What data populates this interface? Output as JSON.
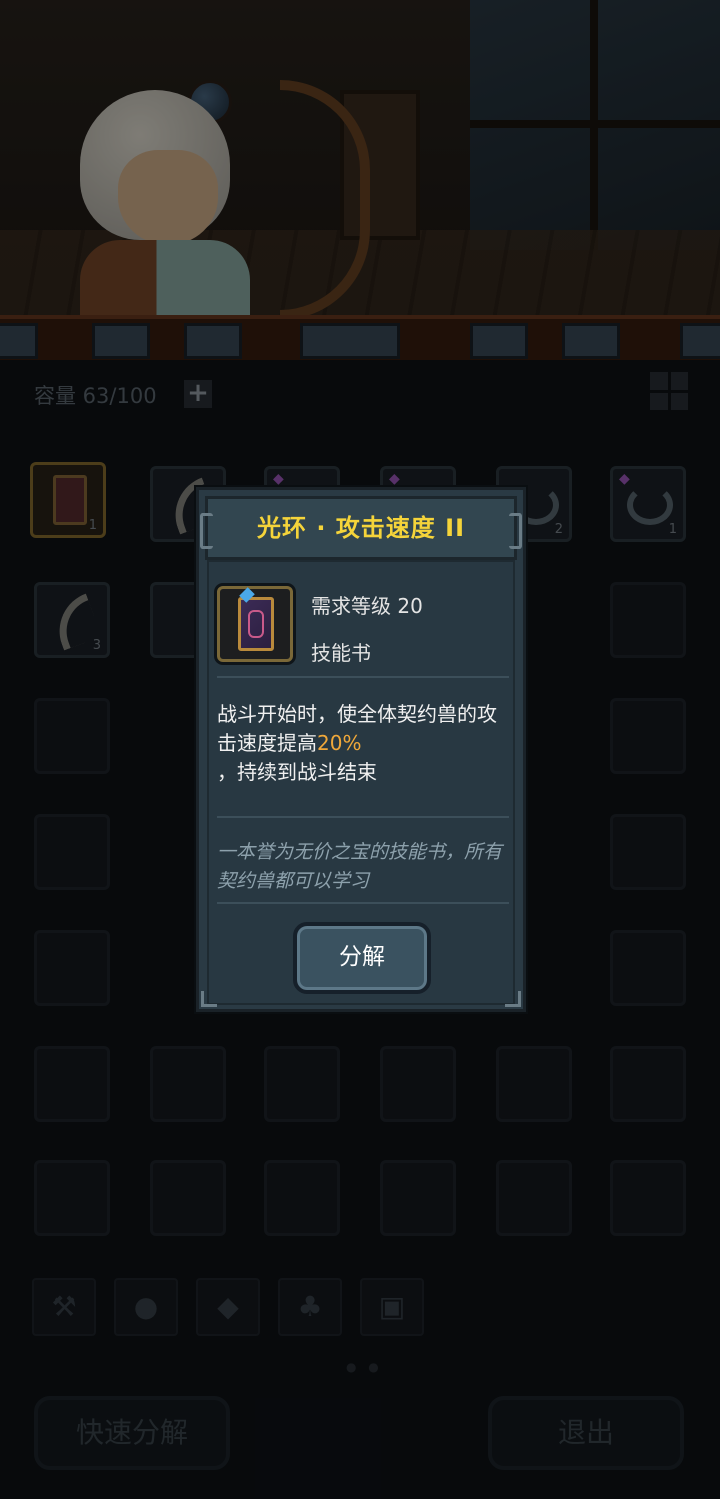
{
  "inventory": {
    "capacity_label": "容量 63/100",
    "plus_icon": "+",
    "row1_counts": [
      "1",
      "",
      "",
      "",
      "2",
      "1"
    ],
    "row2_counts": [
      "3",
      ""
    ]
  },
  "tabs": [
    {
      "icon": "hammer-icon"
    },
    {
      "icon": "paw-icon"
    },
    {
      "icon": "diamond-icon"
    },
    {
      "icon": "leaf-icon"
    },
    {
      "icon": "chest-icon"
    }
  ],
  "bottom": {
    "quick_dismantle": "快速分解",
    "exit": "退出"
  },
  "modal": {
    "title": "光环 · 攻击速度 II",
    "requirement": "需求等级 20",
    "category": "技能书",
    "description_pre": "战斗开始时，使全体契约兽的攻击速度提高",
    "description_highlight": "20%",
    "description_post": "，持续到战斗结束",
    "flavor": "一本誉为无价之宝的技能书，所有契约兽都可以学习",
    "dismantle_label": "分解",
    "highlight_color": "#f0a83a",
    "title_color": "#f5d43a"
  }
}
